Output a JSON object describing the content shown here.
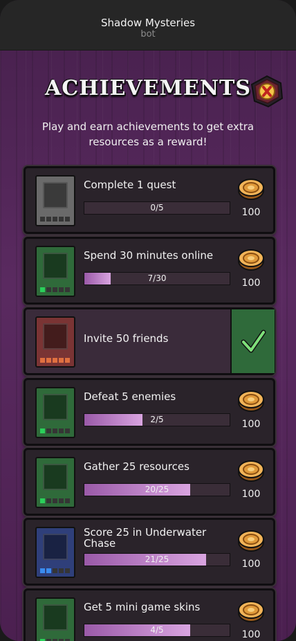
{
  "header": {
    "title": "Shadow Mysteries",
    "subtitle": "bot"
  },
  "screen": {
    "title": "ACHIEVEMENTS",
    "subtitle": "Play and earn achievements to get extra resources as a reward!"
  },
  "achievements": [
    {
      "label": "Complete 1 quest",
      "progress": "0/5",
      "fraction": 0.0,
      "reward": "100",
      "completed": false,
      "theme": "gray",
      "pips_filled": 0
    },
    {
      "label": "Spend 30 minutes online",
      "progress": "7/30",
      "fraction": 0.18,
      "reward": "100",
      "completed": false,
      "theme": "green",
      "pips_filled": 1
    },
    {
      "label": "Invite 50 friends",
      "progress": "",
      "fraction": 1.0,
      "reward": "",
      "completed": true,
      "theme": "red",
      "pips_filled": 5
    },
    {
      "label": "Defeat 5 enemies",
      "progress": "2/5",
      "fraction": 0.4,
      "reward": "100",
      "completed": false,
      "theme": "green",
      "pips_filled": 1
    },
    {
      "label": "Gather 25 resources",
      "progress": "20/25",
      "fraction": 0.73,
      "reward": "100",
      "completed": false,
      "theme": "green",
      "pips_filled": 1
    },
    {
      "label": "Score 25 in Underwater Chase",
      "progress": "21/25",
      "fraction": 0.84,
      "reward": "100",
      "completed": false,
      "theme": "blue",
      "pips_filled": 2
    },
    {
      "label": "Get 5 mini game skins",
      "progress": "4/5",
      "fraction": 0.73,
      "reward": "100",
      "completed": false,
      "theme": "green",
      "pips_filled": 1
    }
  ],
  "colors": {
    "green": "#2f6a3a",
    "red": "#7a3434",
    "blue": "#2f3f7a",
    "gray": "#6a6a6a",
    "pip_green": "#2bd05a",
    "pip_red": "#e07040",
    "pip_blue": "#3a8cf0"
  }
}
